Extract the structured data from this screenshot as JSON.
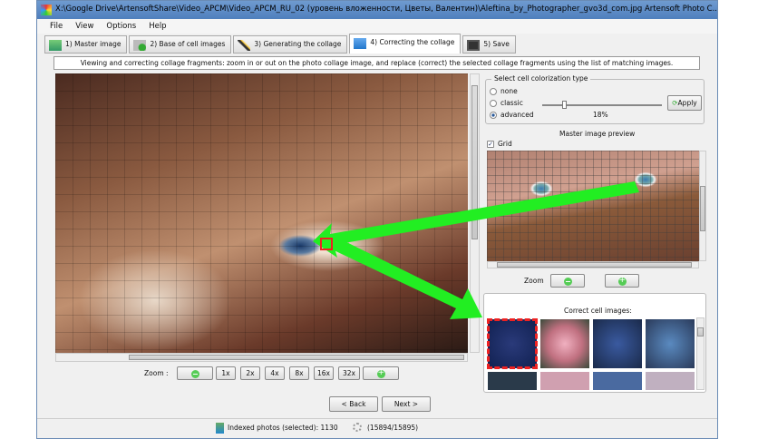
{
  "window": {
    "title": "X:\\Google Drive\\ArtensoftShare\\Video_APCM\\Video_APCM_RU_02 (уровень вложенности, Цветы, Валентин)\\Aleftina_by_Photographer_gvo3d_com.jpg Artensoft Photo C..."
  },
  "menu": [
    "File",
    "View",
    "Options",
    "Help"
  ],
  "tabs": [
    {
      "label": "1) Master image"
    },
    {
      "label": "2) Base of cell images"
    },
    {
      "label": "3) Generating the collage"
    },
    {
      "label": "4) Correcting the collage"
    },
    {
      "label": "5) Save"
    }
  ],
  "description": "Viewing and correcting collage fragments: zoom in or out on the photo collage image, and replace (correct) the selected collage fragments using the list of matching images.",
  "zoom": {
    "label": "Zoom  :",
    "levels": [
      "1x",
      "2x",
      "4x",
      "8x",
      "16x",
      "32x"
    ]
  },
  "colorization": {
    "title": "Select cell colorization type",
    "options": [
      "none",
      "classic",
      "advanced"
    ],
    "selected": "advanced",
    "value_label": "18%",
    "value": 18,
    "apply": "Apply"
  },
  "preview": {
    "title": "Master image preview",
    "grid_label": "Grid",
    "grid_checked": true,
    "zoom_label": "Zoom"
  },
  "correct": {
    "title": "Correct cell images:"
  },
  "nav": {
    "back": "< Back",
    "next": "Next >"
  },
  "status": {
    "indexed": "Indexed photos (selected): 1130",
    "progress": "(15894/15895)"
  },
  "colors": {
    "arrow": "#22ee22",
    "selection": "#e22222"
  }
}
